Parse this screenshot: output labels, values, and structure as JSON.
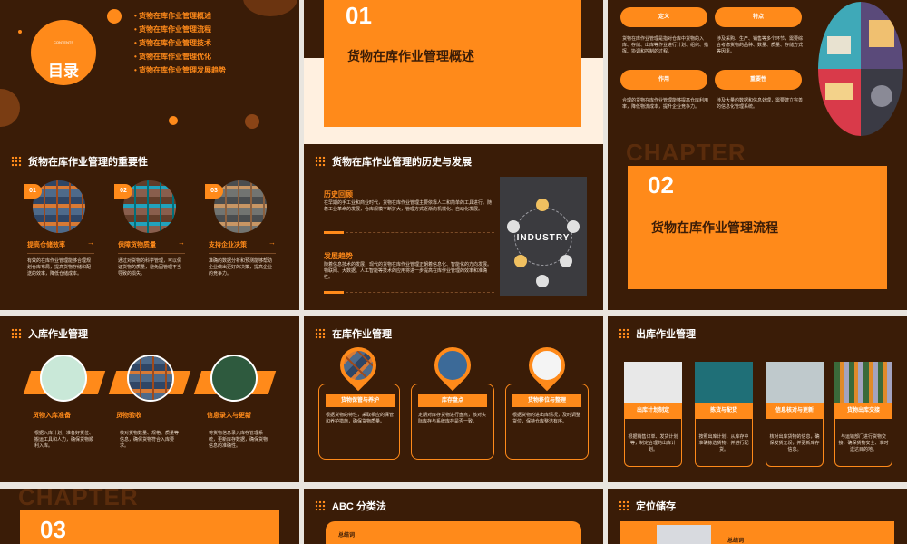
{
  "s1": {
    "title": "目录",
    "subtitle": "CONTENTS",
    "items": [
      "• 货物在库作业管理概述",
      "• 货物在库作业管理流程",
      "• 货物在库作业管理技术",
      "• 货物在库作业管理优化",
      "• 货物在库作业管理发展趋势"
    ]
  },
  "s2": {
    "num": "01",
    "title": "货物在库作业管理概述"
  },
  "s3": {
    "pills": [
      "定义",
      "特点",
      "作用",
      "重要性"
    ],
    "texts": [
      "货物在库作业管理是指对仓库中货物的入库、存储、出库等作业进行计划、组织、指挥、协调和控制的过程。",
      "涉及采购、生产、销售等多个环节，需要综合考虑货物的品种、数量、质量、存储方式等因素。",
      "合理的货物在库作业管理能够提高仓库利用率，降低物流成本，提升企业竞争力。",
      "涉及大量的数据和信息处理，需要建立完善的信息化管理系统。"
    ]
  },
  "s4": {
    "header": "货物在库作业管理的重要性",
    "nums": [
      "01",
      "02",
      "03"
    ],
    "titles": [
      "提高仓储效率",
      "保障货物质量",
      "支持企业决策"
    ],
    "texts": [
      "有效的在库作业管理能够合理规划仓库布局，提高货物存储和配送的效率，降低仓储成本。",
      "通过对货物的科学管理，可以保证货物的质量，避免因管理不当导致的损失。",
      "准确的数据分析和预测能够帮助企业做出更好的决策，提高企业的竞争力。"
    ]
  },
  "s5": {
    "header": "货物在库作业管理的历史与发展",
    "sec1_title": "历史回顾",
    "sec1_text": "在早期的手工业和商业时代，货物在库作业管理主要依靠人工和简单的工具进行。随着工业革命的发展，仓库规模不断扩大，管理方式逐渐向机械化、自动化发展。",
    "sec2_title": "发展趋势",
    "sec2_text": "随着信息技术的发展，现代的货物在库作业管理正朝着信息化、智能化的方向发展。物联网、大数据、人工智能等技术的应用将进一步提高在库作业管理的效率和准确性。",
    "industry": "INDUSTRY"
  },
  "s6": {
    "chapter": "CHAPTER",
    "num": "02",
    "title": "货物在库作业管理流程"
  },
  "s7": {
    "header": "入库作业管理",
    "titles": [
      "货物入库准备",
      "货物验收",
      "信息录入与更新"
    ],
    "texts": [
      "根据入库计划，准备好货位、搬运工具和人力，确保货物顺利入库。",
      "核对货物数量、规格、质量等信息，确保货物符合入库要求。",
      "将货物信息录入库存管理系统，更新库存数据，确保货物信息的准确性。"
    ]
  },
  "s8": {
    "header": "在库作业管理",
    "labels": [
      "货物保管与养护",
      "库存盘点",
      "货物移位与整理"
    ],
    "texts": [
      "根据货物的特性，采取相应的保管和养护措施，确保货物质量。",
      "定期对库存货物进行盘点，核对实际库存与系统库存是否一致。",
      "根据货物的进出库情况，及时调整货位，保持仓库整洁有序。"
    ]
  },
  "s9": {
    "header": "出库作业管理",
    "labels": [
      "出库计划制定",
      "拣货与配货",
      "信息核对与更新",
      "货物出库交接"
    ],
    "texts": [
      "根据销售订单、发货计划等，制定合理的出库计划。",
      "按照出库计划，从库存中准确拣选货物，并进行配货。",
      "核对出库货物的信息，确保发货无误，并更新库存信息。",
      "与运输部门进行货物交接，确保货物安全、准时送达目的地。"
    ]
  },
  "s10": {
    "chapter": "CHAPTER",
    "num": "03"
  },
  "s11": {
    "header": "ABC 分类法",
    "box_label": "总结词"
  },
  "s12": {
    "header": "定位储存",
    "box_label": "总结词"
  },
  "colors": {
    "accent": "#ff8a1a",
    "bg": "#3a1c07"
  }
}
